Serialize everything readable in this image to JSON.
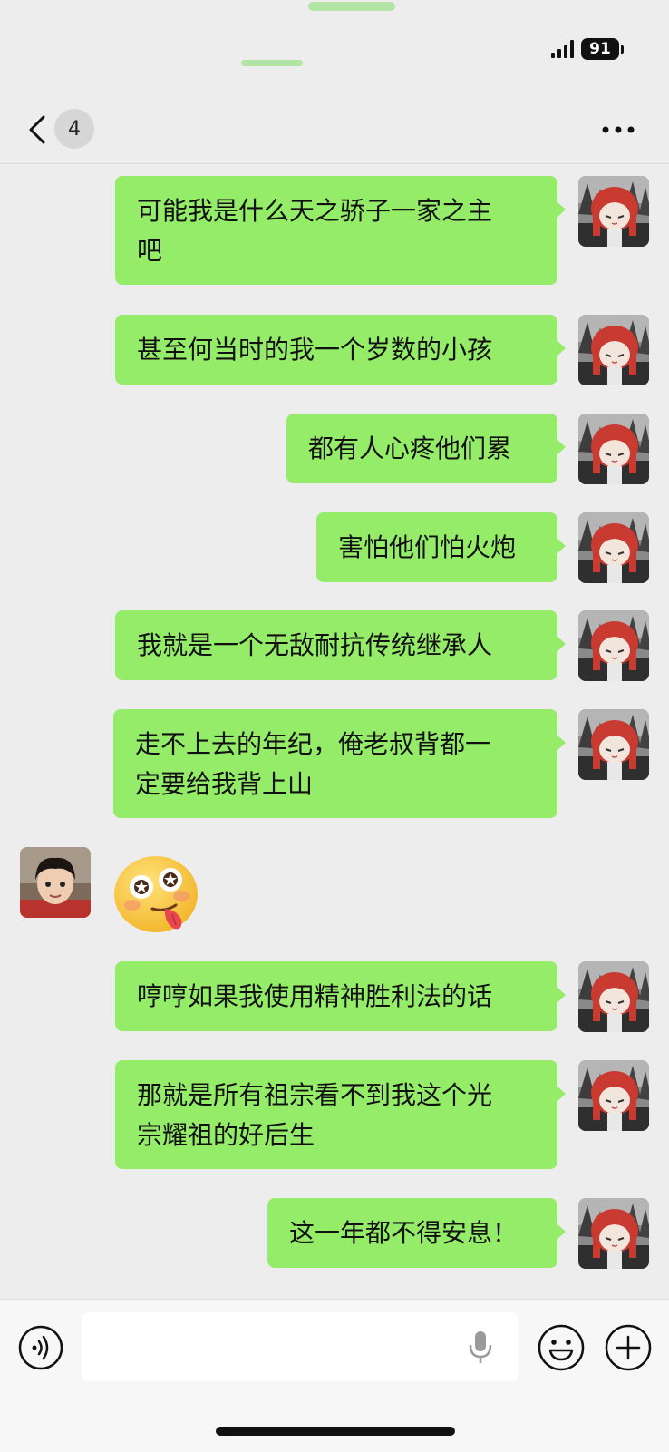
{
  "status_bar": {
    "battery_level": "91",
    "signal_icon": "signal-bars-icon",
    "battery_icon": "battery-icon"
  },
  "header": {
    "back_icon": "chevron-left-icon",
    "unread_count": "4",
    "more_icon": "more-horizontal-icon"
  },
  "messages": [
    {
      "sender": "me",
      "text": "可能我是什么天之骄子一家之主\n吧"
    },
    {
      "sender": "me",
      "text": "甚至何当时的我一个岁数的小孩"
    },
    {
      "sender": "me",
      "text": "都有人心疼他们累"
    },
    {
      "sender": "me",
      "text": "害怕他们怕火炮"
    },
    {
      "sender": "me",
      "text": "我就是一个无敌耐抗传统继承人"
    },
    {
      "sender": "me",
      "text": "走不上去的年纪，俺老叔背都一\n定要给我背上山"
    },
    {
      "sender": "other",
      "type": "sticker",
      "sticker": "starry-eyes-tongue-emoji"
    },
    {
      "sender": "me",
      "text": "哼哼如果我使用精神胜利法的话"
    },
    {
      "sender": "me",
      "text": "那就是所有祖宗看不到我这个光\n宗耀祖的好后生"
    },
    {
      "sender": "me",
      "text": "这一年都不得安息！"
    }
  ],
  "input_bar": {
    "voice_icon": "voice-mode-icon",
    "mic_icon": "microphone-icon",
    "emoji_icon": "emoji-face-icon",
    "plus_icon": "plus-circle-icon",
    "input_value": ""
  },
  "colors": {
    "background": "#ededed",
    "bubble_green": "#95ec69",
    "input_bar": "#f7f7f7"
  }
}
